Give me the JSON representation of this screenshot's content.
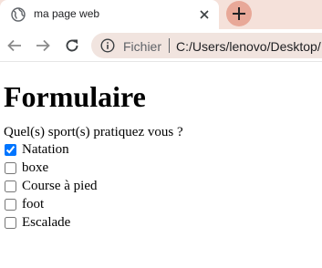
{
  "browser": {
    "tab_title": "ma page web",
    "omnibox_label": "Fichier",
    "url": "C:/Users/lenovo/Desktop/",
    "accent_color": "#e8a898",
    "icons": [
      "globe-icon",
      "close-icon",
      "plus-icon",
      "back-arrow-icon",
      "forward-arrow-icon",
      "reload-icon",
      "info-icon"
    ]
  },
  "page": {
    "heading": "Formulaire",
    "question": "Quel(s) sport(s) pratiquez vous ?",
    "options": [
      {
        "label": "Natation",
        "checked": true
      },
      {
        "label": "boxe",
        "checked": false
      },
      {
        "label": "Course à pied",
        "checked": false
      },
      {
        "label": "foot",
        "checked": false
      },
      {
        "label": "Escalade",
        "checked": false
      }
    ]
  }
}
